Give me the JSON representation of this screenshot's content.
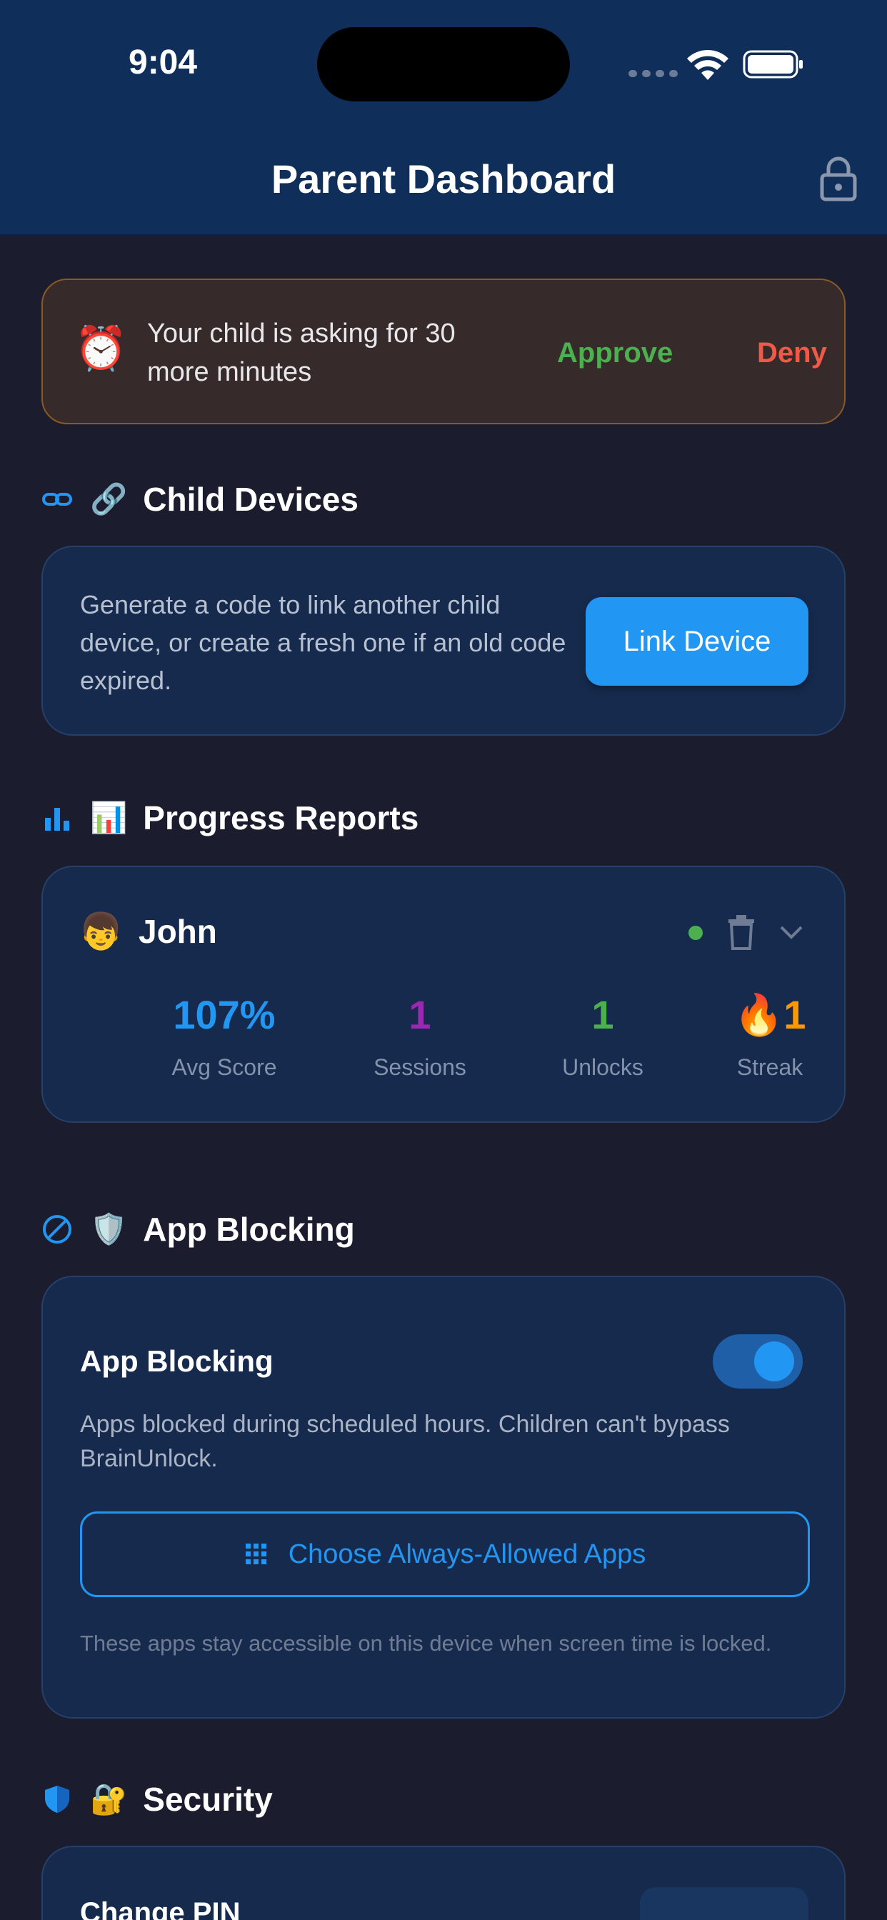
{
  "status_bar": {
    "time": "9:04"
  },
  "header": {
    "title": "Parent Dashboard"
  },
  "request_alert": {
    "icon": "alarm-clock",
    "message": "Your child is asking for 30 more minutes",
    "approve_label": "Approve",
    "deny_label": "Deny"
  },
  "child_devices": {
    "emoji": "🔗",
    "title": "Child Devices",
    "description": "Generate a code to link another child device, or create a fresh one if an old code expired.",
    "button_label": "Link Device"
  },
  "progress_reports": {
    "emoji": "📊",
    "title": "Progress Reports",
    "child": {
      "avatar": "👦",
      "name": "John",
      "online": true,
      "stats": [
        {
          "value": "107%",
          "label": "Avg Score",
          "color": "#2196f3"
        },
        {
          "value": "1",
          "label": "Sessions",
          "color": "#9c27b0"
        },
        {
          "value": "1",
          "label": "Unlocks",
          "color": "#4caf50"
        },
        {
          "value": "🔥1",
          "label": "Streak",
          "color": "#ff9800"
        }
      ]
    }
  },
  "app_blocking": {
    "emoji": "🛡️",
    "title": "App Blocking",
    "card_title": "App Blocking",
    "enabled": true,
    "description": "Apps blocked during scheduled hours. Children can't bypass BrainUnlock.",
    "allowed_button_label": "Choose Always-Allowed Apps",
    "note": "These apps stay accessible on this device when screen time is locked."
  },
  "security": {
    "emoji": "🔐",
    "title": "Security",
    "change_pin_label": "Change PIN"
  },
  "colors": {
    "background": "#1b1c2e",
    "header": "#0f2e5a",
    "card": "#152a4c",
    "accent": "#2196f3",
    "approve": "#4caf50",
    "deny": "#ef5a48"
  }
}
